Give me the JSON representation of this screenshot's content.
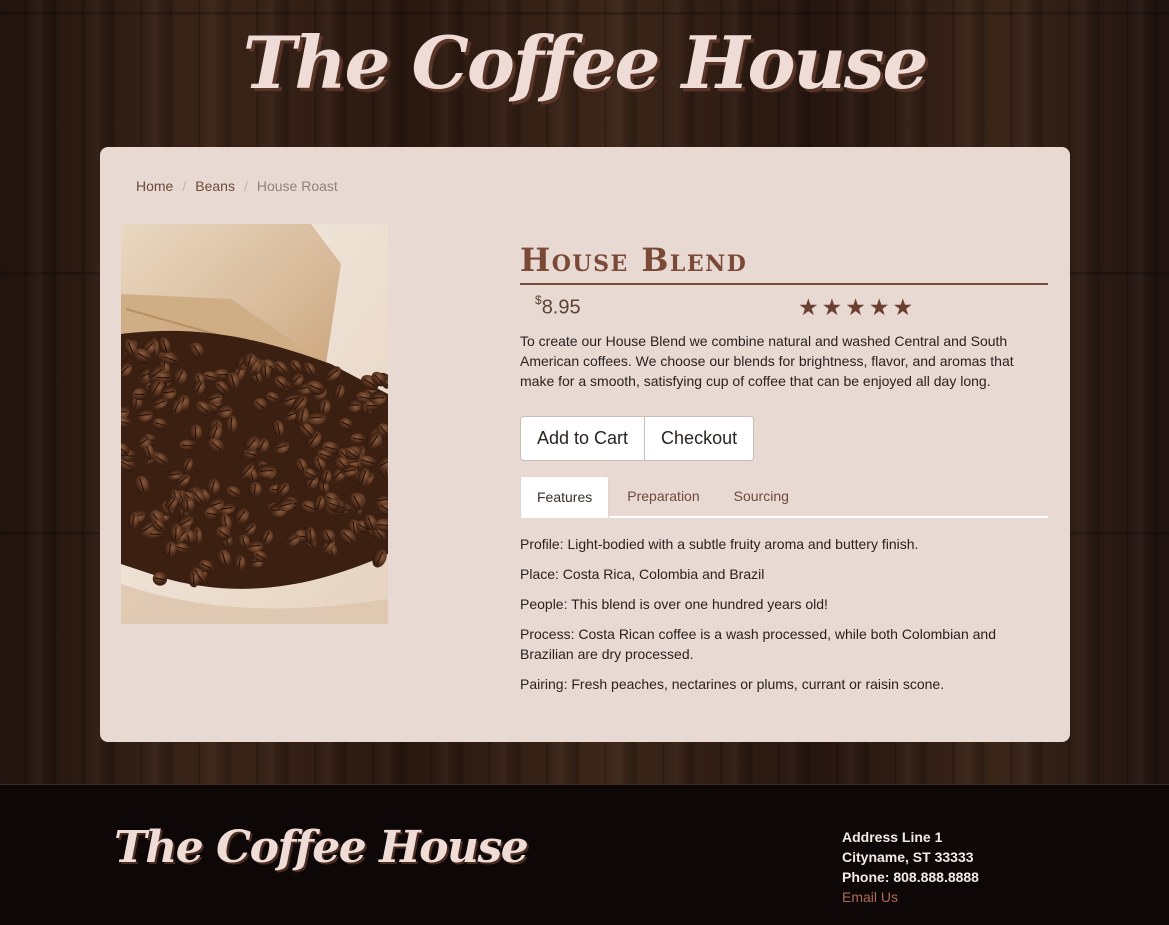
{
  "header": {
    "title": "The Coffee House"
  },
  "breadcrumb": {
    "items": [
      {
        "label": "Home"
      },
      {
        "label": "Beans"
      },
      {
        "label": "House Roast"
      }
    ],
    "separator": "/"
  },
  "product": {
    "name": "House Blend",
    "currency_symbol": "$",
    "price": "8.95",
    "rating": {
      "stars": 5,
      "max": 5,
      "glyphs": "★★★★★"
    },
    "description": "To create our House Blend we combine natural and washed Central and South American coffees. We choose our blends for brightness, flavor, and aromas that make for a smooth, satisfying cup of coffee that can be enjoyed all day long.",
    "buttons": {
      "add_to_cart": "Add to Cart",
      "checkout": "Checkout"
    },
    "tabs": [
      {
        "label": "Features",
        "active": true
      },
      {
        "label": "Preparation",
        "active": false
      },
      {
        "label": "Sourcing",
        "active": false
      }
    ],
    "features": [
      "Profile: Light-bodied with a subtle fruity aroma and buttery finish.",
      "Place: Costa Rica, Colombia and Brazil",
      "People: This blend is over one hundred years old!",
      "Process: Costa Rican coffee is a wash processed, while both Colombian and Brazilian are dry processed.",
      "Pairing: Fresh peaches, nectarines or plums, currant or raisin scone."
    ]
  },
  "footer": {
    "title": "The Coffee House",
    "address_line": "Address Line 1",
    "city": "Cityname, ST 33333",
    "phone": "Phone: 808.888.8888",
    "email_link": "Email Us"
  },
  "colors": {
    "panel_bg": "#e8d9d3",
    "accent_brown": "#7b4937",
    "link": "#6b4a3b",
    "email_link": "#b06a55"
  },
  "icons": {
    "rating": "star-icon",
    "image": "coffee-beans-photo"
  }
}
